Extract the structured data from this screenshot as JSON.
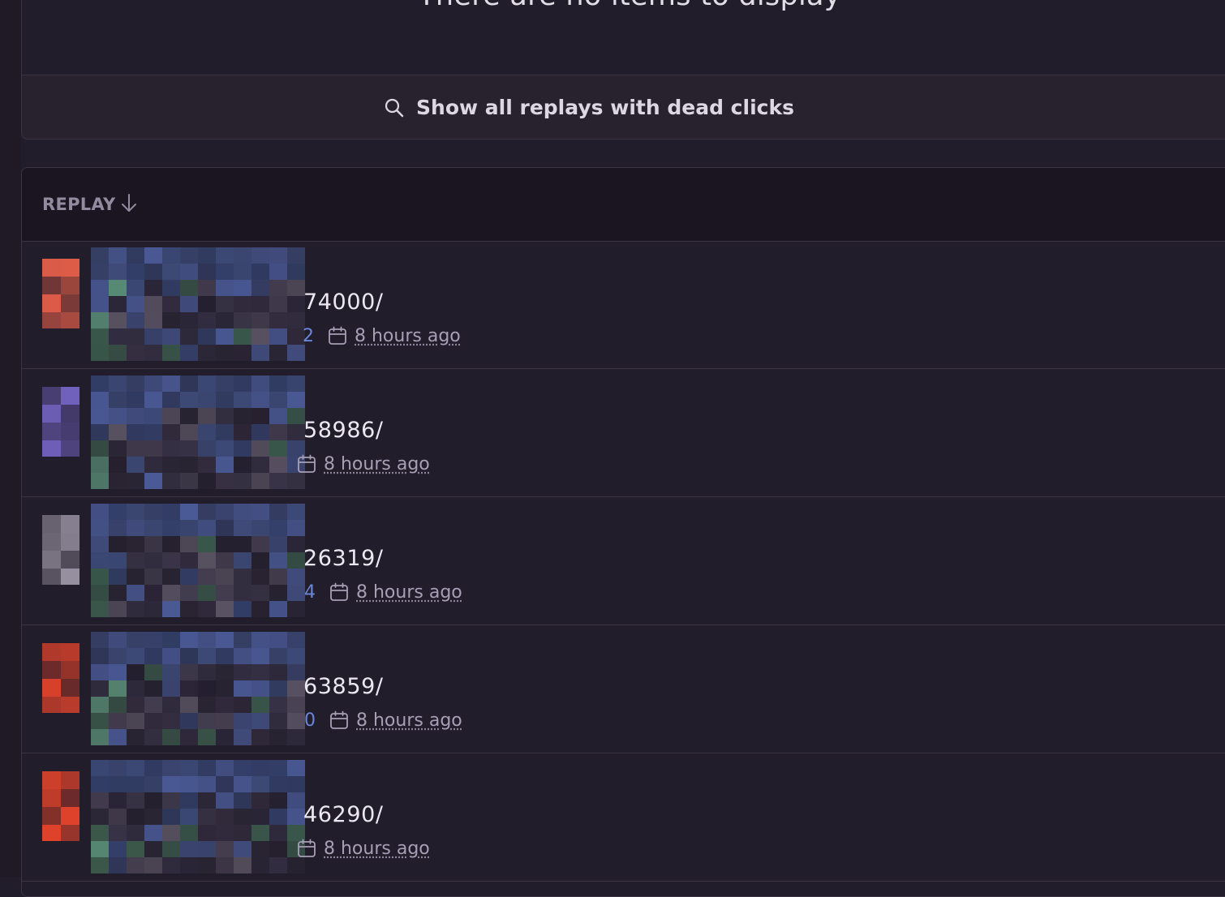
{
  "empty_state": {
    "message": "There are no items to display",
    "show_all_label": "Show all replays with dead clicks",
    "show_all_icon": "search-icon"
  },
  "table": {
    "column_header": "REPLAY",
    "sort_icon": "arrow-down-icon",
    "rows": [
      {
        "url_visible": "74000/",
        "id_tail": "2",
        "time": "8 hours ago",
        "avatar_color": "#e8604a"
      },
      {
        "url_visible": "58986/",
        "id_tail": "",
        "time": "8 hours ago",
        "avatar_color": "#7b6ad0"
      },
      {
        "url_visible": "26319/",
        "id_tail": "4",
        "time": "8 hours ago",
        "avatar_color": "#9a93a4"
      },
      {
        "url_visible": "63859/",
        "id_tail": "0",
        "time": "8 hours ago",
        "avatar_color": "#e2432c"
      },
      {
        "url_visible": "46290/",
        "id_tail": "",
        "time": "8 hours ago",
        "avatar_color": "#e2432c"
      }
    ]
  },
  "colors": {
    "background": "#221d2a",
    "header_background": "#1a1520",
    "border": "#3a3445",
    "link_blue": "#6a86d8"
  }
}
